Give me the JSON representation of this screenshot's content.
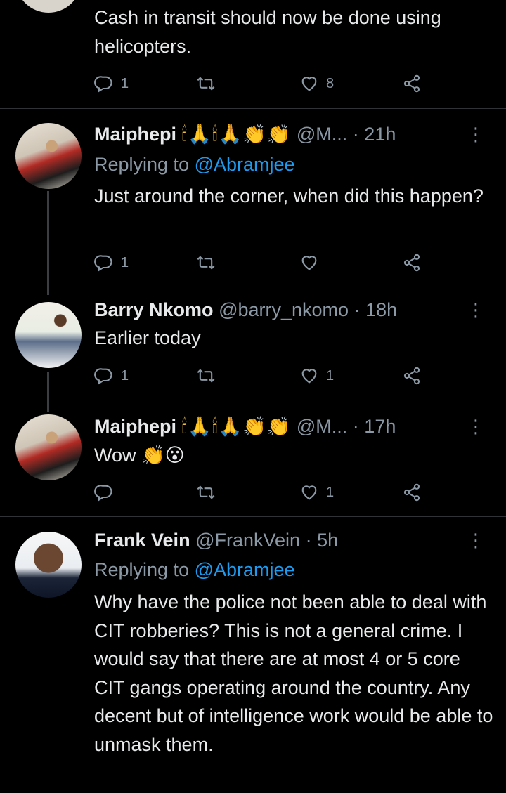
{
  "tweets": [
    {
      "text": "Cash in transit should now be done using helicopters.",
      "actions": {
        "reply_count": "1",
        "retweet_count": "",
        "like_count": "8"
      }
    },
    {
      "name": "Maiphepi",
      "name_emoji": "🕯🙏🕯🙏👏👏",
      "handle": "@M...",
      "time": "21h",
      "replying_label": "Replying to",
      "replying_to": "@Abramjee",
      "text": "Just around the corner, when did this happen?",
      "actions": {
        "reply_count": "1",
        "retweet_count": "",
        "like_count": ""
      }
    },
    {
      "name": "Barry Nkomo",
      "handle": "@barry_nkomo",
      "time": "18h",
      "text": "Earlier today",
      "actions": {
        "reply_count": "1",
        "retweet_count": "",
        "like_count": "1"
      }
    },
    {
      "name": "Maiphepi",
      "name_emoji": "🕯🙏🕯🙏👏👏",
      "handle": "@M...",
      "time": "17h",
      "text": "Wow 👏😮",
      "actions": {
        "reply_count": "",
        "retweet_count": "",
        "like_count": "1"
      }
    },
    {
      "name": "Frank Vein",
      "handle": "@FrankVein",
      "time": "5h",
      "replying_label": "Replying to",
      "replying_to": "@Abramjee",
      "text": "Why have the police not been able to deal with CIT robberies? This is not a general crime. I would say that there are at most 4 or 5 core CIT gangs operating around the country. Any decent but of intelligence work would be able to unmask them."
    }
  ],
  "ui": {
    "dot": "·",
    "more_icon": "⋮"
  },
  "colors": {
    "background": "#000000",
    "text": "#e7e9ea",
    "muted": "#8b98a5",
    "link": "#1d9bf0"
  }
}
